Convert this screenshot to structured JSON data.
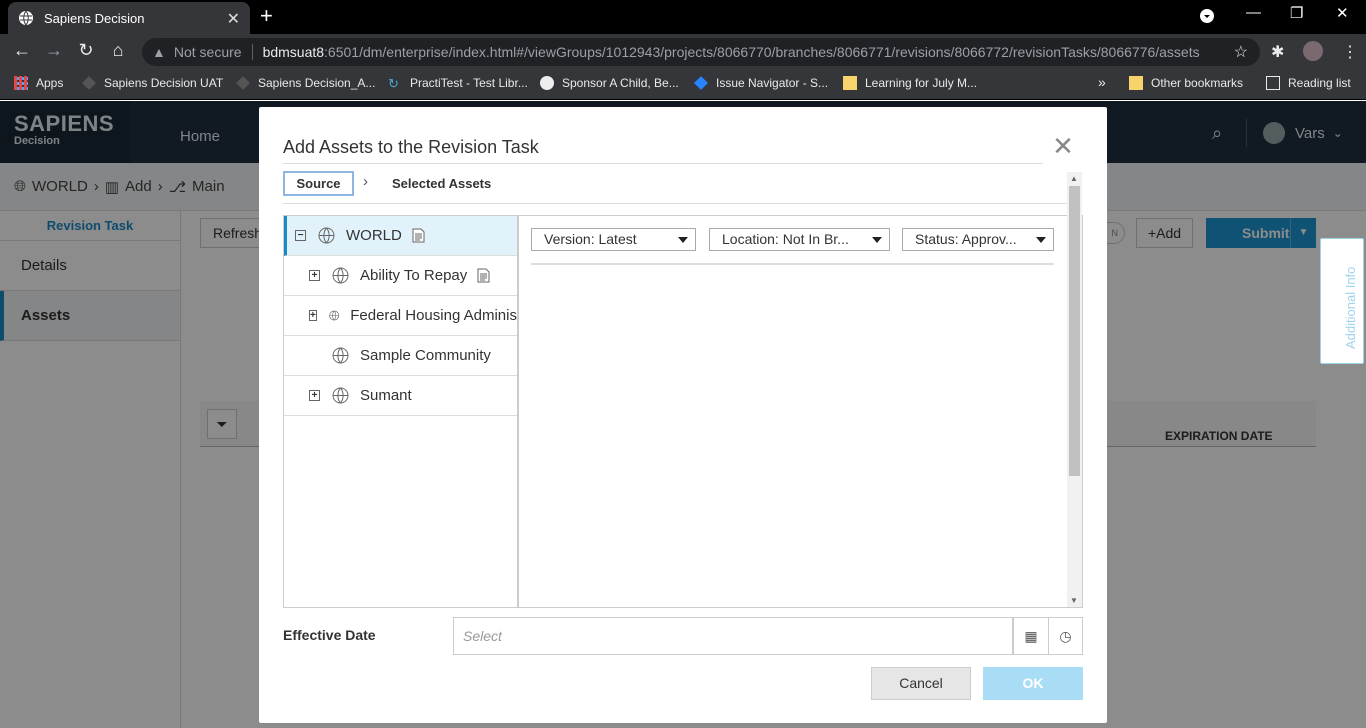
{
  "browser": {
    "tab_title": "Sapiens Decision",
    "new_tab": "+",
    "not_secure": "Not secure",
    "url_host": "bdmsuat8",
    "url_rest": ":6501/dm/enterprise/index.html#/viewGroups/1012943/projects/8066770/branches/8066771/revisions/8066772/revisionTasks/8066776/assets",
    "bookmarks": [
      "Apps",
      "Sapiens Decision UAT",
      "Sapiens Decision_A...",
      "PractiTest - Test Libr...",
      "Sponsor A Child, Be...",
      "Issue Navigator - S...",
      "Learning for July M..."
    ],
    "bookmarks_more": "»",
    "other_bookmarks": "Other bookmarks",
    "reading_list": "Reading list"
  },
  "app": {
    "logo_main": "SAPIENS",
    "logo_sub": "Decision",
    "nav_home": "Home",
    "user_name": "Vars",
    "breadcrumb": [
      "WORLD",
      "Add",
      "Main"
    ],
    "sidebar_title": "Revision Task",
    "sidebar_items": [
      "Details",
      "Assets"
    ],
    "refresh_label": "Refresh",
    "toggle_label": "N",
    "add_label": "+Add",
    "submit_label": "Submit",
    "expiration_header": "EXPIRATION DATE",
    "additional_info": "Additional Info"
  },
  "modal": {
    "title": "Add Assets to the Revision Task",
    "step_source": "Source",
    "step_selected": "Selected Assets",
    "tree": [
      {
        "label": "WORLD",
        "expander": "−"
      },
      {
        "label": "Ability To Repay",
        "expander": "+"
      },
      {
        "label": "Federal Housing Adminis",
        "expander": "+"
      },
      {
        "label": "Sample Community",
        "expander": ""
      },
      {
        "label": "Sumant",
        "expander": "+"
      }
    ],
    "filters": [
      "Version: Latest",
      "Location: Not In Br...",
      "Status: Approv..."
    ],
    "effective_date_label": "Effective Date",
    "effective_date_placeholder": "Select",
    "cancel_label": "Cancel",
    "ok_label": "OK"
  }
}
